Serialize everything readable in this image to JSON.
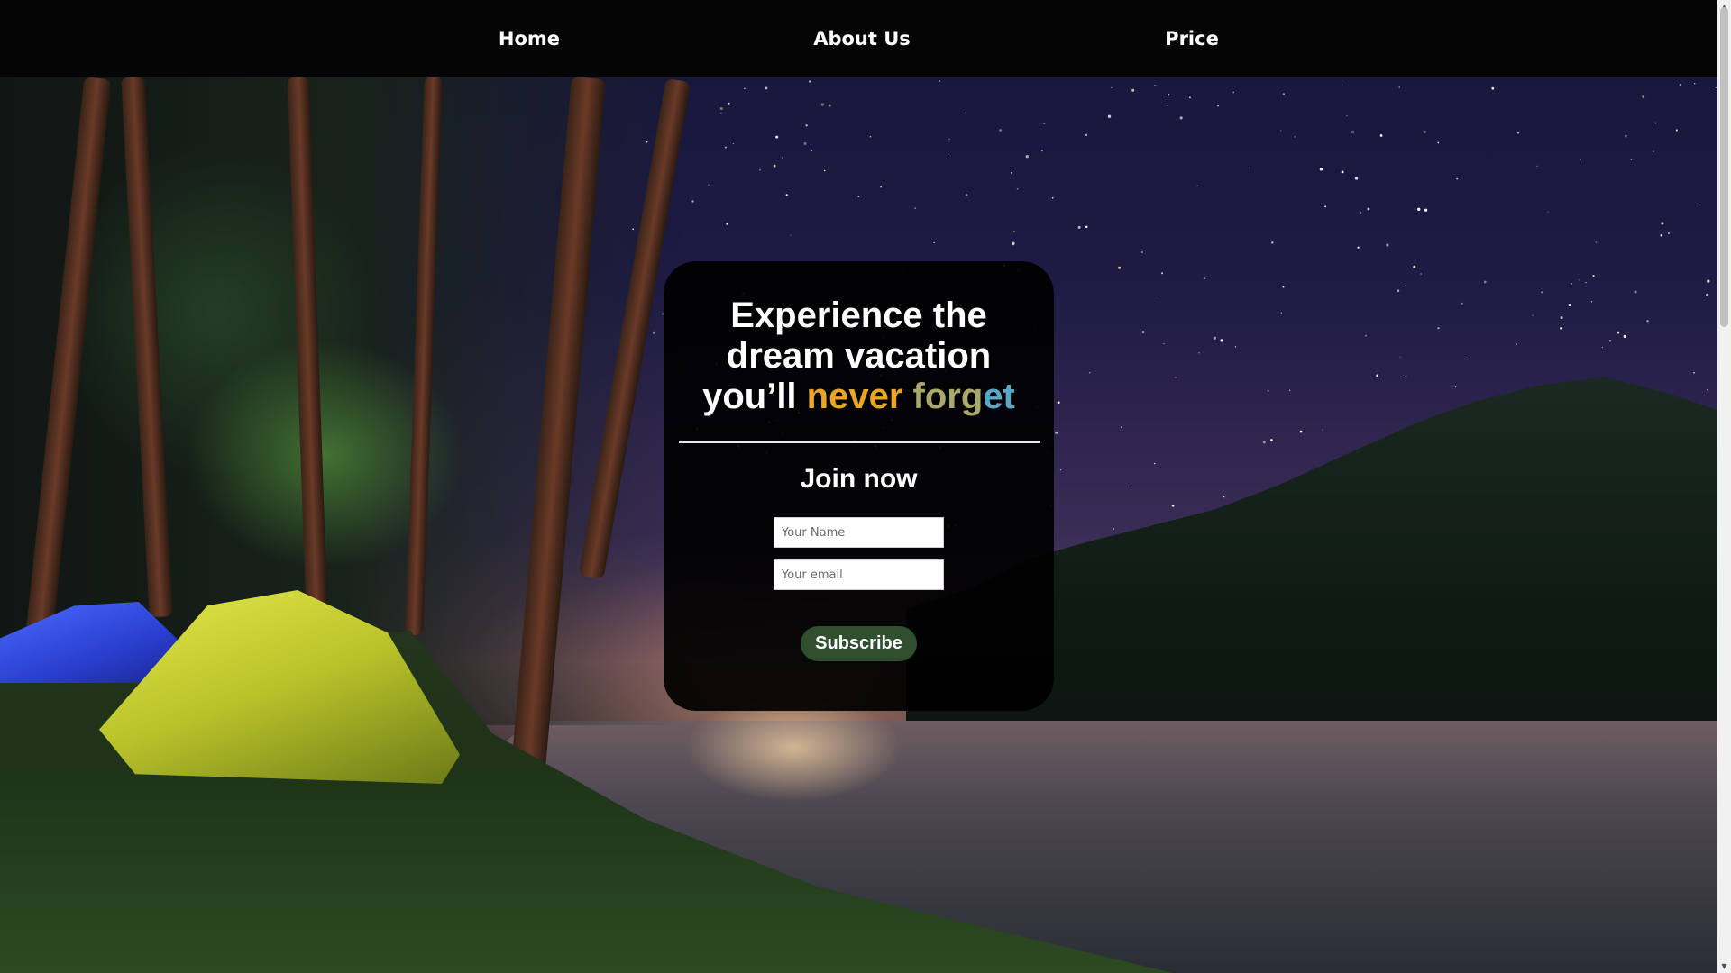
{
  "nav": {
    "items": [
      {
        "label": "Home"
      },
      {
        "label": "About Us"
      },
      {
        "label": "Price"
      }
    ]
  },
  "hero": {
    "headline_line1": "Experience the",
    "headline_line2": "dream vacation",
    "headline_line3_prefix": "you’ll ",
    "headline_accent_word1": "never",
    "headline_accent_word2_part1": "forg",
    "headline_accent_word2_part2": "et",
    "join_title": "Join now",
    "name_placeholder": "Your Name",
    "email_placeholder": "Your email",
    "subscribe_label": "Subscribe"
  },
  "colors": {
    "navbar": "#050505",
    "card_background": "#000000",
    "accent_orange": "#e9a524",
    "accent_olive": "#a8a96a",
    "accent_blue": "#5aa8c8",
    "subscribe_button": "#2f4f2e"
  },
  "icons": {
    "scroll_up": "scroll-up-arrow-icon",
    "scroll_down": "scroll-down-arrow-icon"
  }
}
